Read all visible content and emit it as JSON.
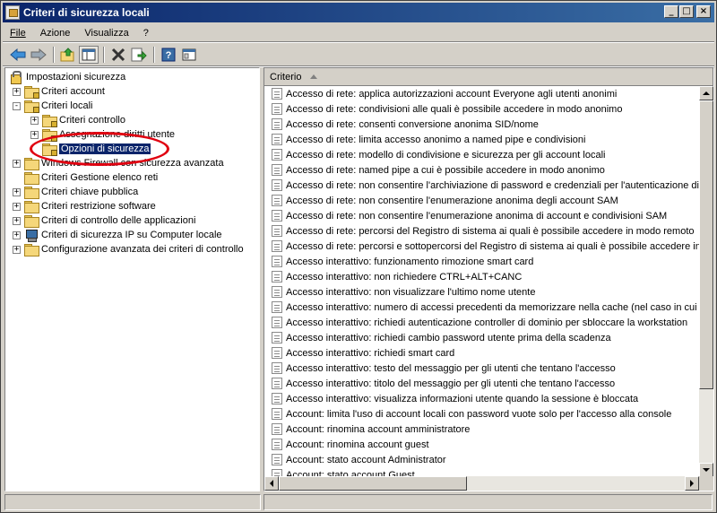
{
  "window": {
    "title": "Criteri di sicurezza locali",
    "buttons": {
      "minimize": "_",
      "maximize": "□",
      "close": "×"
    }
  },
  "menu": [
    "File",
    "Azione",
    "Visualizza",
    "?"
  ],
  "toolbar": {
    "icons": [
      "back-arrow-icon",
      "forward-arrow-icon",
      "up-folder-icon",
      "show-hide-tree-icon",
      "delete-icon",
      "export-list-icon",
      "help-icon",
      "properties-icon"
    ]
  },
  "tree": {
    "root": "Impostazioni sicurezza",
    "items": [
      {
        "label": "Criteri account",
        "level": 1,
        "expander": "+"
      },
      {
        "label": "Criteri locali",
        "level": 1,
        "expander": "-"
      },
      {
        "label": "Criteri controllo",
        "level": 2,
        "expander": "+"
      },
      {
        "label": "Assegnazione diritti utente",
        "level": 2,
        "expander": "+"
      },
      {
        "label": "Opzioni di sicurezza",
        "level": 2,
        "expander": "",
        "selected": true
      },
      {
        "label": "Windows Firewall con sicurezza avanzata",
        "level": 1,
        "expander": "+"
      },
      {
        "label": "Criteri Gestione elenco reti",
        "level": 1,
        "expander": ""
      },
      {
        "label": "Criteri chiave pubblica",
        "level": 1,
        "expander": "+"
      },
      {
        "label": "Criteri restrizione software",
        "level": 1,
        "expander": "+"
      },
      {
        "label": "Criteri di controllo delle applicazioni",
        "level": 1,
        "expander": "+"
      },
      {
        "label": "Criteri di sicurezza IP su Computer locale",
        "level": 1,
        "expander": "+"
      },
      {
        "label": "Configurazione avanzata dei criteri di controllo",
        "level": 1,
        "expander": "+"
      }
    ]
  },
  "list": {
    "column_header": "Criterio",
    "rows": [
      "Accesso di rete: applica autorizzazioni account Everyone agli utenti anonimi",
      "Accesso di rete: condivisioni alle quali è possibile accedere in modo anonimo",
      "Accesso di rete: consenti conversione anonima SID/nome",
      "Accesso di rete: limita accesso anonimo a named pipe e condivisioni",
      "Accesso di rete: modello di condivisione e sicurezza per gli account locali",
      "Accesso di rete: named pipe a cui è possibile accedere in modo anonimo",
      "Accesso di rete: non consentire l'archiviazione di password e credenziali per l'autenticazione di re",
      "Accesso di rete: non consentire l'enumerazione anonima degli account SAM",
      "Accesso di rete: non consentire l'enumerazione anonima di account e condivisioni SAM",
      "Accesso di rete: percorsi del Registro di sistema ai quali è possibile accedere in modo remoto",
      "Accesso di rete: percorsi e sottopercorsi del Registro di sistema ai quali è possibile accedere in m",
      "Accesso interattivo: funzionamento rimozione smart card",
      "Accesso interattivo: non richiedere CTRL+ALT+CANC",
      "Accesso interattivo: non visualizzare l'ultimo nome utente",
      "Accesso interattivo: numero di accessi precedenti da memorizzare nella cache (nel caso in cui il c",
      "Accesso interattivo: richiedi autenticazione controller di dominio per sbloccare la workstation",
      "Accesso interattivo: richiedi cambio password utente prima della scadenza",
      "Accesso interattivo: richiedi smart card",
      "Accesso interattivo: testo del messaggio per gli utenti che tentano l'accesso",
      "Accesso interattivo: titolo del messaggio per gli utenti che tentano l'accesso",
      "Accesso interattivo: visualizza informazioni utente quando la sessione è bloccata",
      "Account: limita l'uso di account locali con password vuote solo per l'accesso alla console",
      "Account: rinomina account amministratore",
      "Account: rinomina account guest",
      "Account: stato account Administrator",
      "Account: stato account Guest"
    ]
  },
  "annotation": {
    "color": "#e00010"
  }
}
